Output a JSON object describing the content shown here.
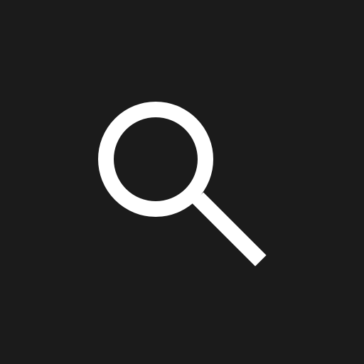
{
  "icon": {
    "name": "search-icon"
  },
  "colors": {
    "background": "#1b1b1b",
    "icon": "#ffffff"
  }
}
